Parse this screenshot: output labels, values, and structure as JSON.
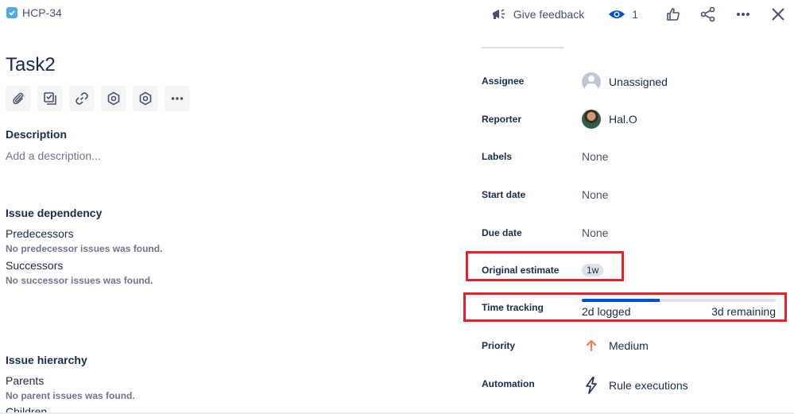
{
  "header": {
    "issue_key": "HCP-34",
    "feedback_label": "Give feedback",
    "watch_count": "1"
  },
  "issue": {
    "title": "Task2"
  },
  "toolbar": {
    "icons": [
      "attach-icon",
      "child-issue-icon",
      "link-icon",
      "hexagon-icon",
      "hexagon-icon",
      "more-icon"
    ]
  },
  "description": {
    "heading": "Description",
    "placeholder": "Add a description..."
  },
  "dependency": {
    "heading": "Issue dependency",
    "predecessors_label": "Predecessors",
    "predecessors_empty": "No predecessor issues was found.",
    "successors_label": "Successors",
    "successors_empty": "No successor issues was found."
  },
  "hierarchy": {
    "heading": "Issue hierarchy",
    "parents_label": "Parents",
    "parents_empty": "No parent issues was found.",
    "children_label": "Children"
  },
  "fields": {
    "assignee": {
      "label": "Assignee",
      "value": "Unassigned"
    },
    "reporter": {
      "label": "Reporter",
      "value": "Hal.O"
    },
    "labels": {
      "label": "Labels",
      "value": "None"
    },
    "start_date": {
      "label": "Start date",
      "value": "None"
    },
    "due_date": {
      "label": "Due date",
      "value": "None"
    },
    "original_estimate": {
      "label": "Original estimate",
      "value": "1w"
    },
    "time_tracking": {
      "label": "Time tracking",
      "logged": "2d logged",
      "remaining": "3d remaining",
      "progress": 0.4
    },
    "priority": {
      "label": "Priority",
      "value": "Medium"
    },
    "automation": {
      "label": "Automation",
      "value": "Rule executions"
    }
  },
  "colors": {
    "highlight": "#e8202a",
    "progress": "#0052cc",
    "priority_medium": "#ff7452"
  }
}
